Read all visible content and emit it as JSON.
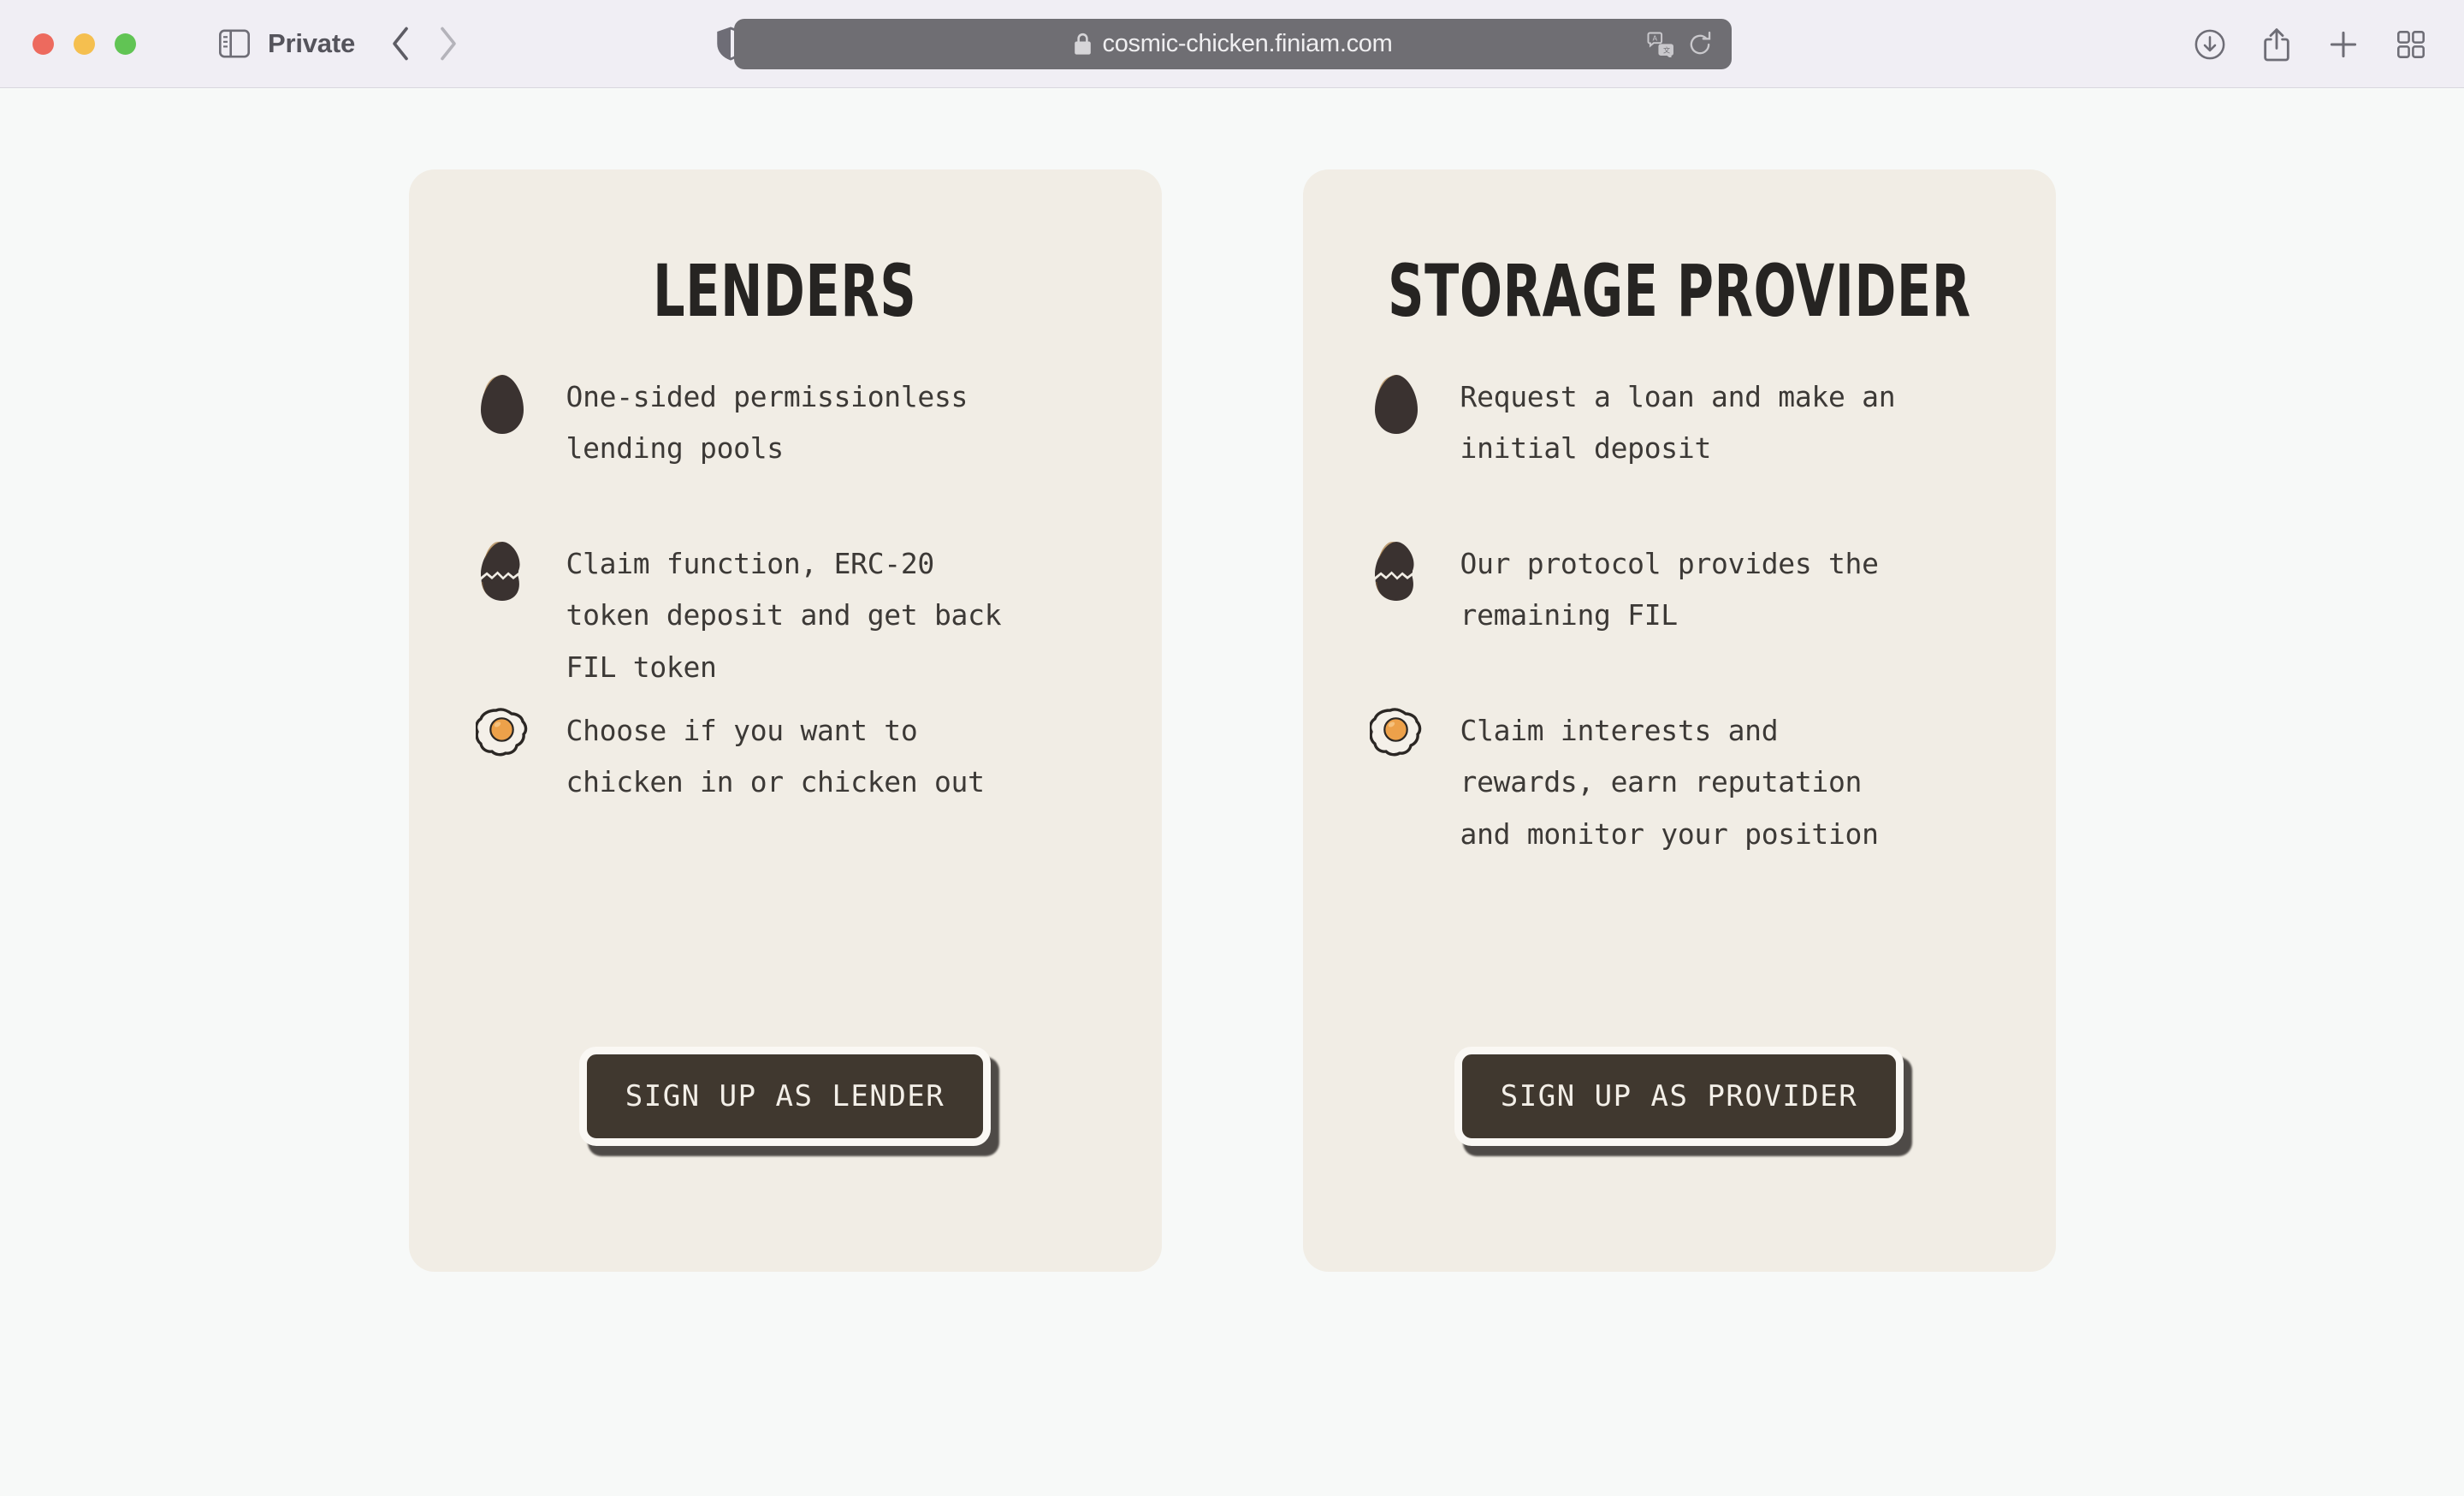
{
  "browser": {
    "window_controls": [
      "close",
      "minimize",
      "maximize"
    ],
    "sidebar_toggle_icon": "sidebar-icon",
    "private_label": "Private",
    "back_icon": "chevron-left-icon",
    "forward_icon": "chevron-right-icon",
    "shield_icon": "privacy-shield-icon",
    "url": {
      "lock_icon": "lock-icon",
      "text": "cosmic-chicken.finiam.com",
      "translate_icon": "translate-icon",
      "reload_icon": "reload-icon"
    },
    "toolbar": {
      "downloads_icon": "downloads-icon",
      "share_icon": "share-icon",
      "new_tab_icon": "plus-icon",
      "tab_overview_icon": "tab-overview-icon"
    }
  },
  "theme": {
    "page_background": "#f7f9f8",
    "card_background": "#f1ede5",
    "text_dark": "#3c3936",
    "title_dark": "#262422",
    "button_background": "#40382f",
    "button_text": "#f3efe8",
    "button_border": "#faf8f4",
    "yolk_orange": "#eda14a",
    "egg_dark": "#3a3230"
  },
  "cards": [
    {
      "title": "LENDERS",
      "features": [
        {
          "icon": "egg-whole-icon",
          "text": "One-sided permissionless\nlending pools"
        },
        {
          "icon": "egg-cracked-icon",
          "text": "Claim function, ERC-20\ntoken deposit and get back\nFIL token"
        },
        {
          "icon": "fried-egg-icon",
          "text": "Choose if you want to\nchicken in or chicken out"
        }
      ],
      "cta_label": "SIGN UP AS LENDER"
    },
    {
      "title": "STORAGE PROVIDER",
      "features": [
        {
          "icon": "egg-whole-icon",
          "text": "Request a loan and make an\ninitial deposit"
        },
        {
          "icon": "egg-cracked-icon",
          "text": "Our protocol provides the\nremaining FIL"
        },
        {
          "icon": "fried-egg-icon",
          "text": "Claim interests and\nrewards, earn reputation\nand monitor your position"
        }
      ],
      "cta_label": "SIGN UP AS PROVIDER"
    }
  ]
}
